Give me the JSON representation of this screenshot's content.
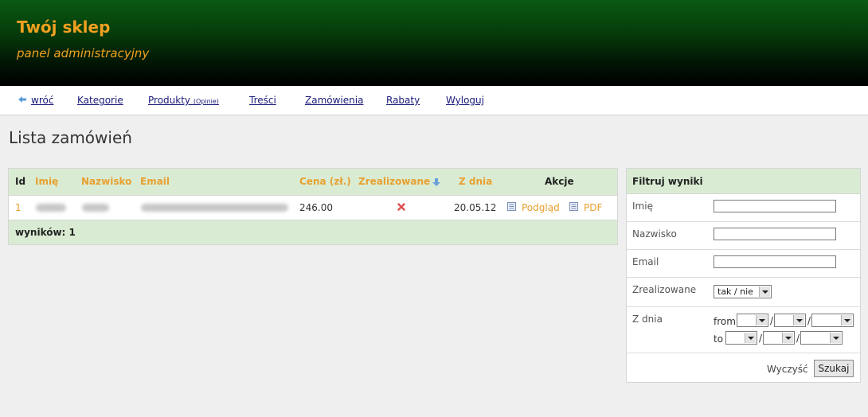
{
  "header": {
    "title": "Twój sklep",
    "subtitle": "panel administracyjny"
  },
  "nav": {
    "back": "wróć",
    "categories": "Kategorie",
    "products": "Produkty",
    "reviews": "(Opinie)",
    "content": "Treści",
    "orders": "Zamówienia",
    "discounts": "Rabaty",
    "logout": "Wyloguj"
  },
  "page_title": "Lista zamówień",
  "table": {
    "headers": {
      "id": "Id",
      "first_name": "Imię",
      "last_name": "Nazwisko",
      "email": "Email",
      "price": "Cena (zł.)",
      "realized": "Zrealizowane",
      "date": "Z dnia",
      "actions": "Akcje"
    },
    "rows": [
      {
        "id": "1",
        "price": "246.00",
        "date": "20.05.12",
        "preview": "Podgląd",
        "pdf": "PDF"
      }
    ],
    "footer": "wyników: 1"
  },
  "filter": {
    "title": "Filtruj wyniki",
    "first_name": "Imię",
    "last_name": "Nazwisko",
    "email": "Email",
    "realized": "Zrealizowane",
    "realized_value": "tak / nie",
    "date": "Z dnia",
    "from": "from",
    "to": "to",
    "clear": "Wyczyść",
    "search": "Szukaj"
  },
  "colors": {
    "accent": "#e8a030",
    "header_green": "#0a5a12",
    "table_head": "#d9ecd3",
    "link": "#1a1a7a"
  }
}
